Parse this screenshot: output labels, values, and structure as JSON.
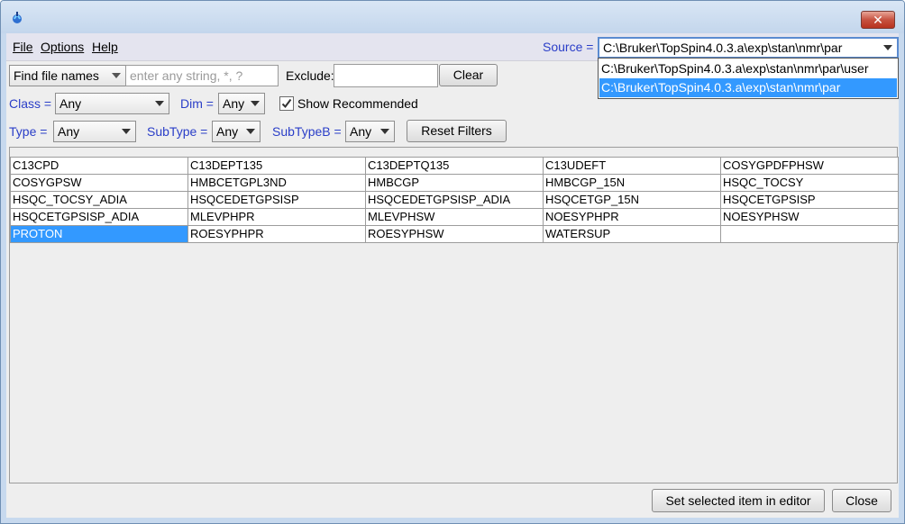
{
  "window": {
    "close_label": "✕"
  },
  "menubar": {
    "file": "File",
    "options": "Options",
    "help": "Help",
    "source_label": "Source =",
    "source_value": "C:\\Bruker\\TopSpin4.0.3.a\\exp\\stan\\nmr\\par",
    "source_options": [
      "C:\\Bruker\\TopSpin4.0.3.a\\exp\\stan\\nmr\\par\\user",
      "C:\\Bruker\\TopSpin4.0.3.a\\exp\\stan\\nmr\\par"
    ],
    "source_selected_index": 1
  },
  "search": {
    "mode_value": "Find file names",
    "placeholder": "enter any string, *, ?",
    "exclude_label": "Exclude:",
    "exclude_value": "",
    "clear_label": "Clear"
  },
  "filters": {
    "class_label": "Class =",
    "class_value": "Any",
    "dim_label": "Dim =",
    "dim_value": "Any",
    "show_recommended_label": "Show Recommended",
    "show_recommended_checked": true,
    "type_label": "Type =",
    "type_value": "Any",
    "subtype_label": "SubType =",
    "subtype_value": "Any",
    "subtypeb_label": "SubTypeB =",
    "subtypeb_value": "Any",
    "reset_label": "Reset Filters"
  },
  "grid": {
    "rows": [
      [
        "C13CPD",
        "C13DEPT135",
        "C13DEPTQ135",
        "C13UDEFT",
        "COSYGPDFPHSW"
      ],
      [
        "COSYGPSW",
        "HMBCETGPL3ND",
        "HMBCGP",
        "HMBCGP_15N",
        "HSQC_TOCSY"
      ],
      [
        "HSQC_TOCSY_ADIA",
        "HSQCEDETGPSISP",
        "HSQCEDETGPSISP_ADIA",
        "HSQCETGP_15N",
        "HSQCETGPSISP"
      ],
      [
        "HSQCETGPSISP_ADIA",
        "MLEVPHPR",
        "MLEVPHSW",
        "NOESYPHPR",
        "NOESYPHSW"
      ],
      [
        "PROTON",
        "ROESYPHPR",
        "ROESYPHSW",
        "WATERSUP",
        ""
      ]
    ],
    "selected": "PROTON"
  },
  "footer": {
    "set_editor_label": "Set selected item in editor",
    "close_label": "Close"
  },
  "colors": {
    "selection": "#3399ff",
    "label_blue": "#2a3ec8"
  }
}
